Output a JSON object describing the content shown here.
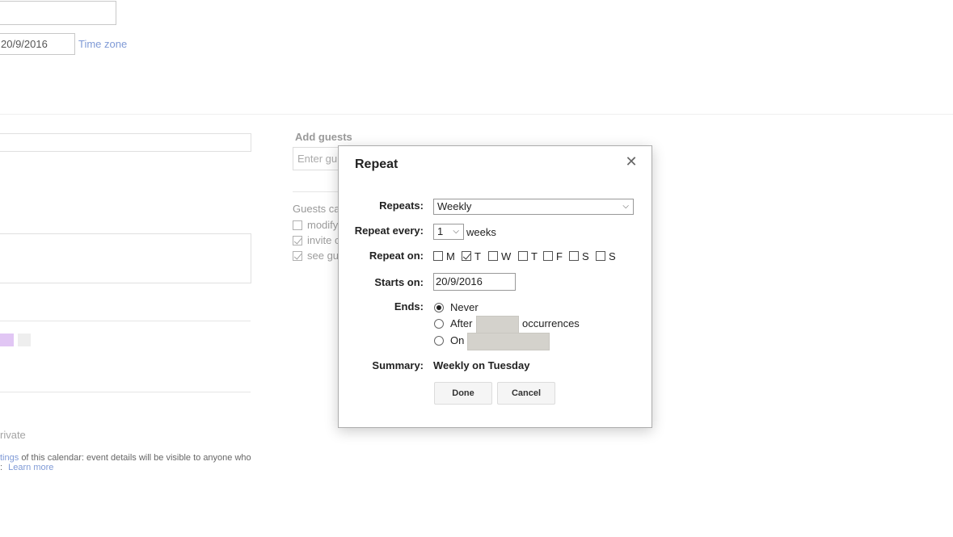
{
  "background": {
    "start_date": "20/9/2016",
    "timezone_link": "Time zone",
    "add_guests_label": "Add guests",
    "guest_input_placeholder": "Enter gu",
    "guests_can_label": "Guests ca",
    "guest_options": [
      "modify",
      "invite c",
      "see gu"
    ],
    "private_label": "rivate",
    "calendar_note_link": "tings",
    "calendar_note_text": "of this calendar: event details will be visible to anyone who",
    "calendar_note_colon": ":",
    "learn_more": "Learn more",
    "swatch_colors": [
      "#e1c6f4",
      "#e8e8e8"
    ]
  },
  "dialog": {
    "title": "Repeat",
    "close_glyph": "✕",
    "repeats_label": "Repeats:",
    "repeats_value": "Weekly",
    "repeat_every_label": "Repeat every:",
    "repeat_every_value": "1",
    "repeat_every_unit": "weeks",
    "repeat_on_label": "Repeat on:",
    "days": [
      {
        "label": "M",
        "checked": false
      },
      {
        "label": "T",
        "checked": true
      },
      {
        "label": "W",
        "checked": false
      },
      {
        "label": "T",
        "checked": false
      },
      {
        "label": "F",
        "checked": false
      },
      {
        "label": "S",
        "checked": false
      },
      {
        "label": "S",
        "checked": false
      }
    ],
    "starts_on_label": "Starts on:",
    "starts_on_value": "20/9/2016",
    "ends_label": "Ends:",
    "ends_never": "Never",
    "ends_after": "After",
    "ends_occurrences": "occurrences",
    "ends_on": "On",
    "summary_label": "Summary:",
    "summary_value": "Weekly on Tuesday",
    "done_label": "Done",
    "cancel_label": "Cancel"
  }
}
